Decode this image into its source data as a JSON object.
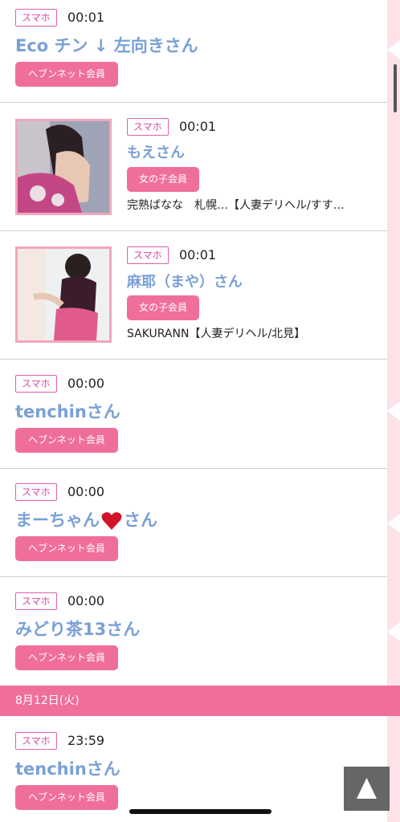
{
  "device_label": "スマホ",
  "member_heaven": "ヘブンネット会員",
  "member_girl": "女の子会員",
  "items": [
    {
      "time": "00:01",
      "name": "Eco チン ↓ 左向きさん"
    },
    {
      "time": "00:01",
      "name": "もえさん",
      "shop": "完熟ばなな　札幌…【人妻デリヘル/すす…"
    },
    {
      "time": "00:01",
      "name": "麻耶（まや）さん",
      "shop": "SAKURANN【人妻デリヘル/北見】"
    },
    {
      "time": "00:00",
      "name": "tenchinさん"
    },
    {
      "time": "00:00",
      "name_pre": "まーちゃん",
      "name_post": "さん"
    },
    {
      "time": "00:00",
      "name": "みどり茶13さん"
    },
    {
      "time": "23:59",
      "name": "tenchinさん"
    }
  ],
  "date_divider": "8月12日(火)",
  "top_button_icon": "up-triangle-icon"
}
